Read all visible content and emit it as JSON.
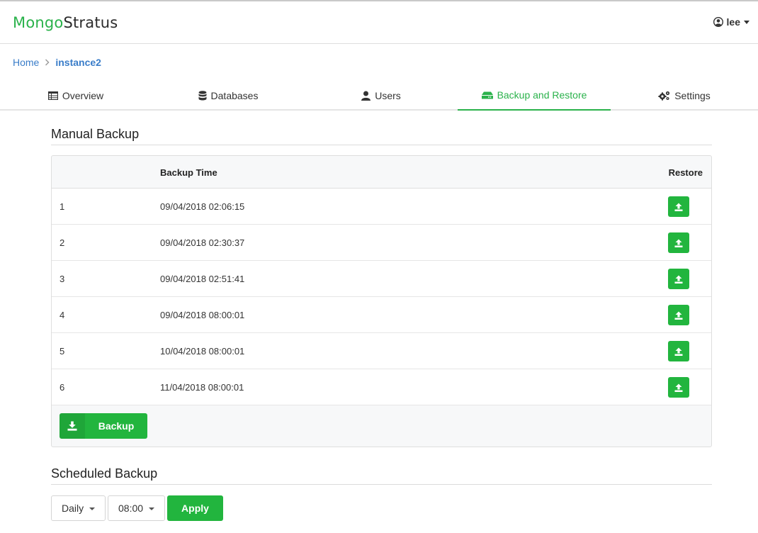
{
  "brand": {
    "part1": "Mongo",
    "part2": "Stratus"
  },
  "user": {
    "name": "lee",
    "icon": "user-circle-icon"
  },
  "breadcrumb": {
    "home": "Home",
    "current": "instance2"
  },
  "tabs": [
    {
      "label": "Overview",
      "icon": "table-icon"
    },
    {
      "label": "Databases",
      "icon": "database-icon"
    },
    {
      "label": "Users",
      "icon": "user-icon"
    },
    {
      "label": "Backup and Restore",
      "icon": "hdd-icon",
      "active": true
    },
    {
      "label": "Settings",
      "icon": "cogs-icon"
    }
  ],
  "manual": {
    "title": "Manual Backup",
    "columns": [
      "",
      "Backup Time",
      "Restore"
    ],
    "rows": [
      {
        "index": "1",
        "time": "09/04/2018 02:06:15"
      },
      {
        "index": "2",
        "time": "09/04/2018 02:30:37"
      },
      {
        "index": "3",
        "time": "09/04/2018 02:51:41"
      },
      {
        "index": "4",
        "time": "09/04/2018 08:00:01"
      },
      {
        "index": "5",
        "time": "10/04/2018 08:00:01"
      },
      {
        "index": "6",
        "time": "11/04/2018 08:00:01"
      }
    ],
    "backup_label": "Backup"
  },
  "scheduled": {
    "title": "Scheduled Backup",
    "frequency": "Daily",
    "time": "08:00",
    "apply_label": "Apply"
  },
  "colors": {
    "accent": "#22b53e",
    "link": "#3a7dc9"
  }
}
